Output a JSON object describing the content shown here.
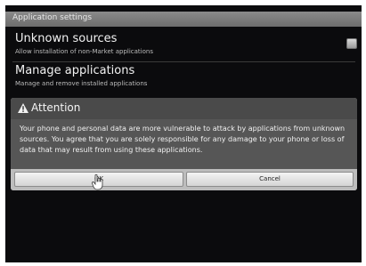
{
  "app": {
    "title": "Application settings"
  },
  "settings": [
    {
      "label": "Unknown sources",
      "summary": "Allow installation of non-Market applications",
      "checked": false
    },
    {
      "label": "Manage applications",
      "summary": "Manage and remove installed applications"
    }
  ],
  "dialog": {
    "icon": "warning-icon",
    "title": "Attention",
    "message": "Your phone and personal data are more vulnerable to attack by applications from unknown sources. You agree that you are solely responsible for any damage to your phone or loss of data that may result from using these applications.",
    "ok_label": "OK",
    "cancel_label": "Cancel"
  },
  "colors": {
    "background": "#0b0b0d",
    "title_bar": "#7a7a7a",
    "dialog_header": "#4a4a4a",
    "dialog_body": "#565656"
  }
}
